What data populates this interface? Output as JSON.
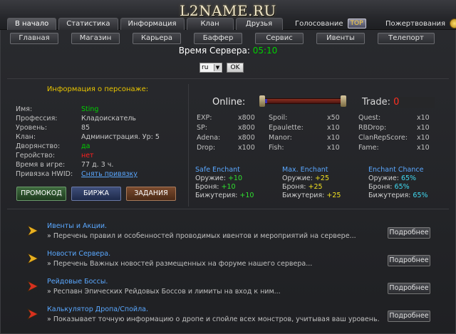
{
  "logo": "L2NAME.RU",
  "tabs": [
    "В начало",
    "Статистика",
    "Информация",
    "Клан",
    "Друзья"
  ],
  "vote_label": "Голосование",
  "vote_badge": "TOP",
  "donate_label": "Пожертвования",
  "nav": [
    "Главная",
    "Магазин",
    "Карьера",
    "Баффер",
    "Сервис",
    "Ивенты",
    "Телепорт"
  ],
  "server_time": {
    "label": "Время Сервера:",
    "value": "05:10"
  },
  "lang": {
    "value": "ru",
    "ok": "OK"
  },
  "character": {
    "title": "Информация о персонаже:",
    "rows": [
      {
        "k": "Имя:",
        "v": "Sting"
      },
      {
        "k": "Профессия:",
        "v": "Кладоискатель"
      },
      {
        "k": "Уровень:",
        "v": "85"
      },
      {
        "k": "Клан:",
        "v": "Администрация. Ур: 5"
      },
      {
        "k": "Дворянство:",
        "v": "да"
      },
      {
        "k": "Геройство:",
        "v": "нет"
      },
      {
        "k": "Время в игре:",
        "v": "77 д. 3 ч."
      },
      {
        "k": "Привязка HWID:",
        "v": "Снять привязку"
      }
    ],
    "buttons": {
      "promo": "ПРОМОКОД",
      "birzha": "БИРЖА",
      "tasks": "ЗАДАНИЯ"
    }
  },
  "online": {
    "label": "Online:",
    "fill": 0.05
  },
  "trade": {
    "label": "Trade:",
    "value": "0"
  },
  "rates": {
    "col1": [
      {
        "k": "EXP:",
        "v": "x800"
      },
      {
        "k": "SP:",
        "v": "x800"
      },
      {
        "k": "Adena:",
        "v": "x800"
      },
      {
        "k": "Drop:",
        "v": "x100"
      }
    ],
    "col2": [
      {
        "k": "Spoil:",
        "v": "x50"
      },
      {
        "k": "Epaulette:",
        "v": "x10"
      },
      {
        "k": "Manor:",
        "v": "x10"
      },
      {
        "k": "Fish:",
        "v": "x10"
      }
    ],
    "col3": [
      {
        "k": "Quest:",
        "v": "x10"
      },
      {
        "k": "RBDrop:",
        "v": "x10"
      },
      {
        "k": "ClanRepScore:",
        "v": "x10"
      },
      {
        "k": "Fame:",
        "v": "x10"
      }
    ]
  },
  "enchant": {
    "safe": {
      "title": "Safe Enchant",
      "rows": [
        {
          "k": "Оружие:",
          "v": "+10"
        },
        {
          "k": "Броня:",
          "v": "+10"
        },
        {
          "k": "Бижутерия:",
          "v": "+10"
        }
      ]
    },
    "max": {
      "title": "Max. Enchant",
      "rows": [
        {
          "k": "Оружие:",
          "v": "+25"
        },
        {
          "k": "Броня:",
          "v": "+25"
        },
        {
          "k": "Бижутерия:",
          "v": "+25"
        }
      ]
    },
    "chance": {
      "title": "Enchant Chance",
      "rows": [
        {
          "k": "Оружие:",
          "v": "65%"
        },
        {
          "k": "Броня:",
          "v": "65%"
        },
        {
          "k": "Бижутерия:",
          "v": "65%"
        }
      ]
    }
  },
  "news": [
    {
      "title": "Ивенты и Акции.",
      "desc": "» Перечень правил и особенностей проводимых ивентов и мероприятий на сервере...",
      "more": "Подробнее",
      "arrow_color": "#e8b020"
    },
    {
      "title": "Новости Сервера.",
      "desc": "» Перечень Важных новостей размещенных на форуме нашего сервера...",
      "more": "Подробнее",
      "arrow_color": "#e8b020"
    },
    {
      "title": "Рейдовые Боссы.",
      "desc": "» Респавн Эпических Рейдовых Боссов и лимиты на вход к ним...",
      "more": "Подробнее",
      "arrow_color": "#d83020"
    },
    {
      "title": "Калькулятор Дропа/Спойла.",
      "desc": "» Показывает точную информацию о дропе и спойле всех монстров, учитывая ваш уровень.",
      "more": "Подробнее",
      "arrow_color": "#d83020"
    }
  ]
}
